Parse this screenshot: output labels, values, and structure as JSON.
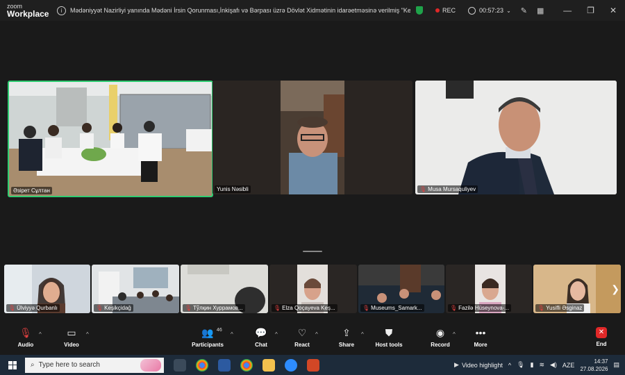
{
  "app": {
    "logo_top": "zoom",
    "logo_bottom": "Workplace"
  },
  "meeting": {
    "title": "Mədəniyyət Nazirliyi yanında Mədəni İrsin Qorunması,İnkişafı və Bərpası üzrə Dövlət Xidmətinin idarəetməsinə verilmiş \"Keşikçi",
    "rec_label": "REC",
    "elapsed": "00:57:23"
  },
  "main_participants": [
    {
      "name": "Әзірет Сұлтан",
      "muted": false
    },
    {
      "name": "Yunis Nəsibli",
      "muted": false
    },
    {
      "name": "Musa Mursaquliyev",
      "muted": true
    }
  ],
  "strip_participants": [
    {
      "name": "Ülviyyə Qurbanlı",
      "muted": true
    },
    {
      "name": "Keşikçidağ",
      "muted": true
    },
    {
      "name": "Тўлқин Хуррамов...",
      "muted": true
    },
    {
      "name": "Elza Qoçayeva Keş...",
      "muted": true
    },
    {
      "name": "Museums_Samark...",
      "muted": true
    },
    {
      "name": "Fazilə Hüseynova-...",
      "muted": true
    },
    {
      "name": "Yusifli Əsginaz",
      "muted": true
    }
  ],
  "controls": {
    "audio": "Audio",
    "video": "Video",
    "participants": "Participants",
    "participants_count": "46",
    "chat": "Chat",
    "react": "React",
    "share": "Share",
    "host_tools": "Host tools",
    "record": "Record",
    "more": "More",
    "end": "End"
  },
  "taskbar": {
    "search_placeholder": "Type here to search",
    "video_highlight": "Video highlight",
    "lang": "AZE",
    "time": "14:37",
    "date": "27.08.2026"
  },
  "colors": {
    "active_speaker_border": "#2ecc71",
    "rec_dot": "#e02828",
    "end_button": "#e02828",
    "secure_shield": "#1fa34a"
  }
}
